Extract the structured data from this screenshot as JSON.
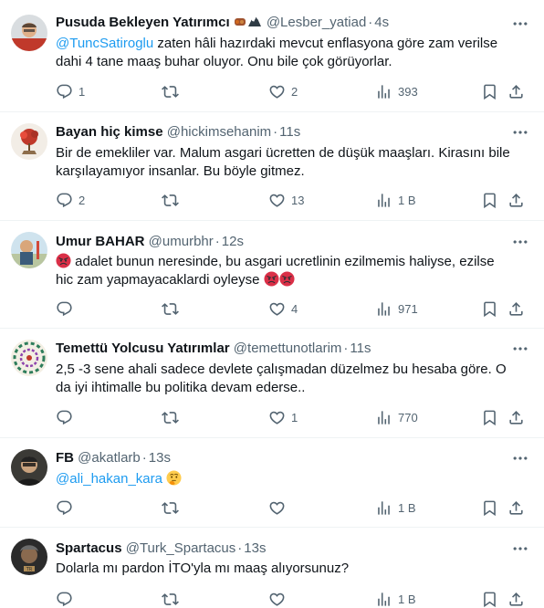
{
  "tweets": [
    {
      "name": "Pusuda Bekleyen Yatırımcı",
      "handle": "@Lesber_yatiad",
      "time": "4s",
      "mention": "@TuncSatiroglu",
      "line1": " zaten hâli hazırdaki mevcut enflasyona göre zam verilse",
      "line2": "dahi 4 tane maaş buhar oluyor. Onu bile çok görüyorlar.",
      "replies": "1",
      "retweets": "",
      "likes": "2",
      "views": "393"
    },
    {
      "name": "Bayan hiç kimse",
      "handle": "@hickimsehanim",
      "time": "11s",
      "line1": "Bir de emekliler var.  Malum asgari ücretten de düşük maaşları. Kirasını bile",
      "line2": "karşılayamıyor insanlar.  Bu böyle gitmez.",
      "replies": "2",
      "retweets": "",
      "likes": "13",
      "views": "1 B"
    },
    {
      "name": "Umur BAHAR",
      "handle": "@umurbhr",
      "time": "12s",
      "line1": " adalet bunun neresinde, bu asgari ucretlinin ezilmemis haliyse, ezilse",
      "line2": "hic zam yapmayacaklardi oyleyse ",
      "replies": "",
      "retweets": "",
      "likes": "4",
      "views": "971"
    },
    {
      "name": "Temettü Yolcusu Yatırımlar",
      "handle": "@temettunotlarim",
      "time": "11s",
      "line1": "2,5 -3 sene ahali sadece devlete çalışmadan düzelmez bu hesaba göre. O",
      "line2": "da iyi ihtimalle bu politika devam ederse..",
      "replies": "",
      "retweets": "",
      "likes": "1",
      "views": "770"
    },
    {
      "name": "FB",
      "handle": "@akatlarb",
      "time": "13s",
      "mention": "@ali_hakan_kara",
      "replies": "",
      "retweets": "",
      "likes": "",
      "views": "1 B"
    },
    {
      "name": "Spartacus",
      "handle": "@Turk_Spartacus",
      "time": "13s",
      "line1": "Dolarla mı pardon İTO'yla mı maaş alıyorsunuz?",
      "replies": "",
      "retweets": "",
      "likes": "",
      "views": "1 B"
    }
  ],
  "dot": "·",
  "icons": [
    "reply-icon",
    "retweet-icon",
    "like-icon",
    "views-icon",
    "bookmark-icon",
    "share-icon",
    "more-icon"
  ],
  "colors": {
    "text": "#0f1419",
    "secondary": "#536471",
    "link": "#1d9bf0",
    "divider": "#eff3f4"
  }
}
